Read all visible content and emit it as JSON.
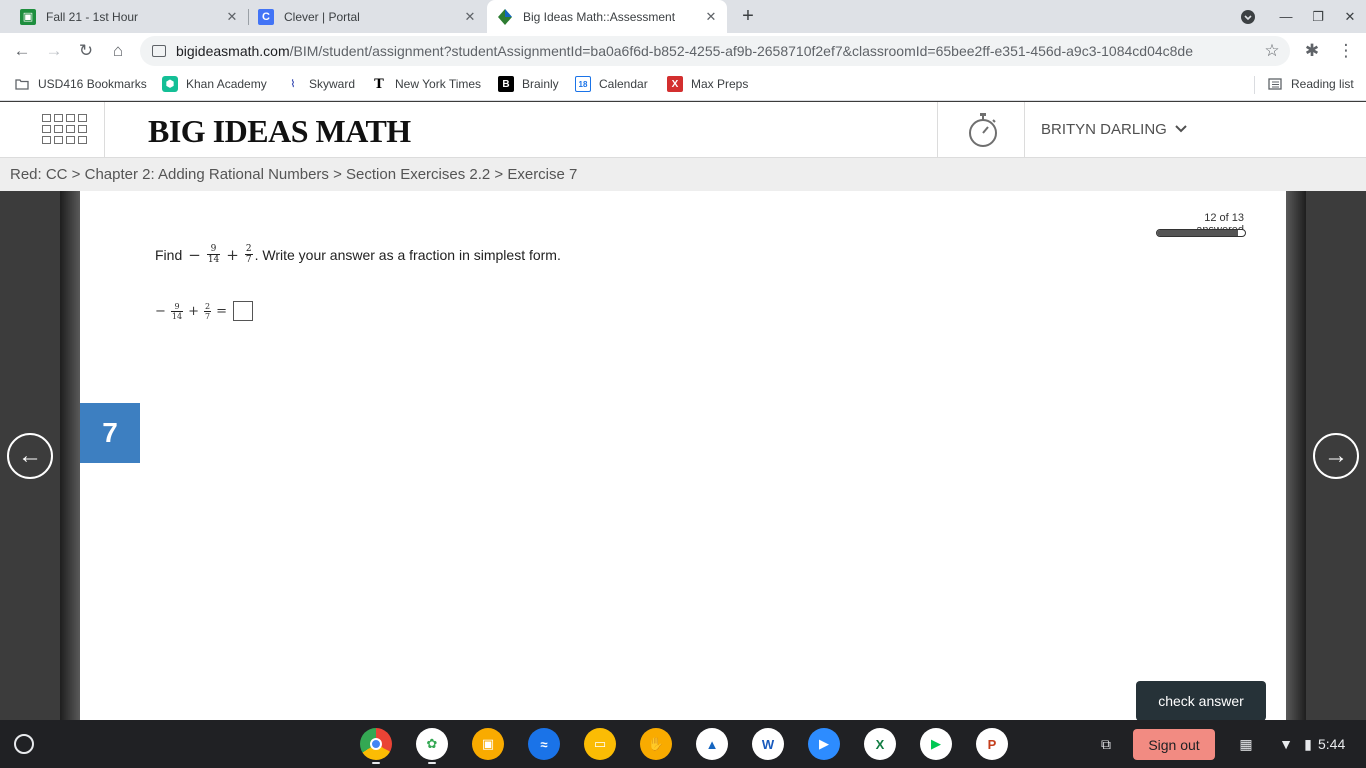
{
  "browser": {
    "tabs": [
      {
        "title": "Fall 21 - 1st Hour",
        "icon": "classroom-icon",
        "color": "#1e8e3e"
      },
      {
        "title": "Clever | Portal",
        "icon": "clever-icon",
        "color": "#4274f6"
      },
      {
        "title": "Big Ideas Math::Assessment",
        "icon": "bim-icon",
        "color": "#2f7d32",
        "active": true
      }
    ],
    "url_host": "bigideasmath.com",
    "url_path": "/BIM/student/assignment?studentAssignmentId=ba0a6f6d-b852-4255-af9b-2658710f2ef7&classroomId=65bee2ff-e351-456d-a9c3-1084cd04c8de",
    "bookmarks": [
      {
        "label": "USD416 Bookmarks",
        "icon": "folder-icon"
      },
      {
        "label": "Khan Academy",
        "icon": "khan-academy-icon"
      },
      {
        "label": "Skyward",
        "icon": "skyward-icon"
      },
      {
        "label": "New York Times",
        "icon": "nyt-icon"
      },
      {
        "label": "Brainly",
        "icon": "brainly-icon"
      },
      {
        "label": "Calendar",
        "icon": "calendar-icon"
      },
      {
        "label": "Max Preps",
        "icon": "maxpreps-icon"
      }
    ],
    "reading_list": "Reading list"
  },
  "site": {
    "logo": "BIG IDEAS MATH",
    "user_name": "BRITYN DARLING"
  },
  "breadcrumb": "Red: CC > Chapter 2: Adding Rational Numbers > Section Exercises 2.2 > Exercise 7",
  "progress": {
    "label": "12 of 13 answered",
    "answered": 12,
    "total": 13
  },
  "question": {
    "prefix": "Find",
    "minus": "−",
    "plus": "+",
    "equals": "=",
    "frac1": {
      "num": "9",
      "den": "14"
    },
    "frac2": {
      "num": "2",
      "den": "7"
    },
    "suffix": ". Write your answer as a fraction in simplest form."
  },
  "exercise_number": "7",
  "nav": {
    "prev": "←",
    "next": "→"
  },
  "check_answer_label": "check answer",
  "shelf": {
    "apps": [
      "chrome-icon",
      "photos-icon",
      "files-icon",
      "earth-icon",
      "slides-icon",
      "keep-icon",
      "pdf-icon",
      "word-icon",
      "zoom-icon",
      "excel-icon",
      "play-store-icon",
      "powerpoint-icon"
    ],
    "sign_out": "Sign out",
    "time": "5:44"
  }
}
